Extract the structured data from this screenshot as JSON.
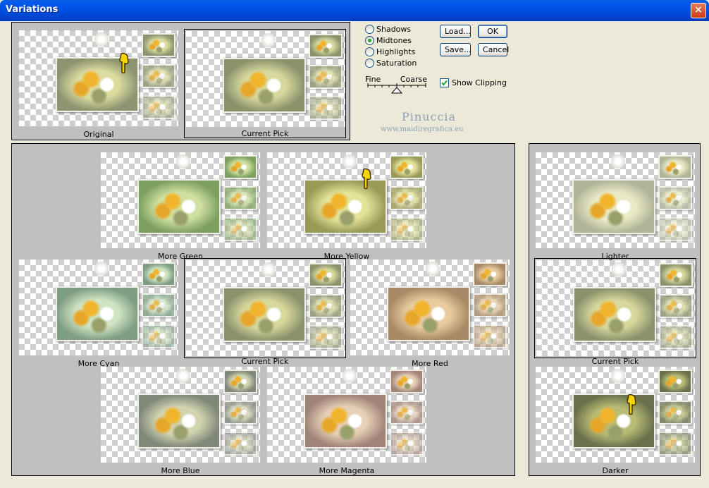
{
  "window": {
    "title": "Variations",
    "close_symbol": "×"
  },
  "thumbnails": {
    "original": {
      "label": "Original"
    },
    "current_pick_top": {
      "label": "Current Pick"
    },
    "more_green": {
      "label": "More Green"
    },
    "more_yellow": {
      "label": "More Yellow"
    },
    "lighter": {
      "label": "Lighter"
    },
    "more_cyan": {
      "label": "More Cyan"
    },
    "current_pick_center": {
      "label": "Current Pick"
    },
    "more_red": {
      "label": "More Red"
    },
    "current_pick_right": {
      "label": "Current Pick"
    },
    "more_blue": {
      "label": "More Blue"
    },
    "more_magenta": {
      "label": "More Magenta"
    },
    "darker": {
      "label": "Darker"
    }
  },
  "tone_range": {
    "options": [
      "Shadows",
      "Midtones",
      "Highlights",
      "Saturation"
    ],
    "selected": "Midtones"
  },
  "buttons": {
    "load": "Load...",
    "save": "Save...",
    "ok": "OK",
    "cancel": "Cancel"
  },
  "slider": {
    "fine_label": "Fine",
    "coarse_label": "Coarse"
  },
  "show_clipping": {
    "label": "Show Clipping",
    "checked": true
  },
  "watermark": {
    "name": "Pinuccia",
    "url": "www.maidiregrafica.eu"
  },
  "colors": {
    "title_bar": "#0058ee",
    "dialog_bg": "#ece9d8",
    "panel_bg": "#c0c0c0",
    "watermark": "#8c9fb8",
    "radio_dot": "#21a121"
  }
}
